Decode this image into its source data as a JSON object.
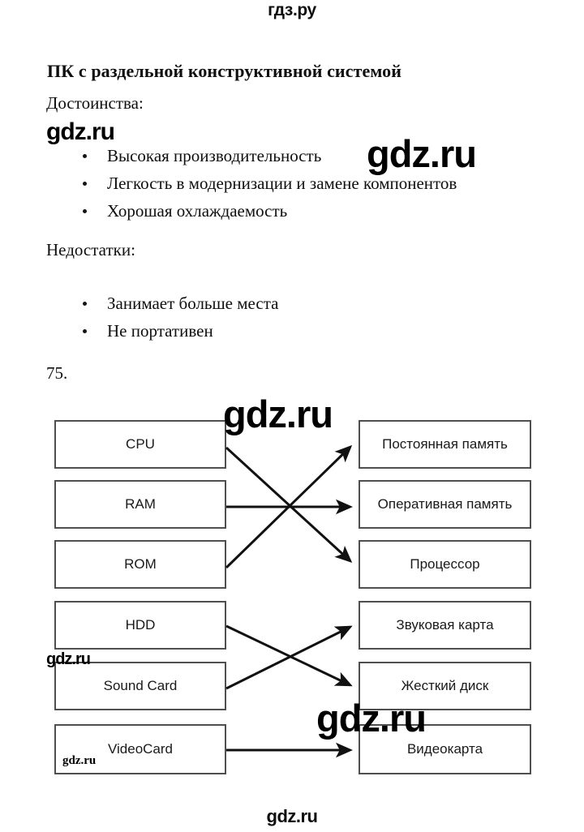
{
  "branding": {
    "header": "гдз.ру",
    "footer": "gdz.ru",
    "watermark": "gdz.ru"
  },
  "document": {
    "title": "ПК с раздельной конструктивной системой",
    "pros_label": "Достоинства:",
    "pros": [
      "Высокая производительность",
      "Легкость в модернизации и замене компонентов",
      "Хорошая охлаждаемость"
    ],
    "cons_label": "Недостатки:",
    "cons": [
      "Занимает больше места",
      "Не портативен"
    ],
    "task_number": "75."
  },
  "diagram": {
    "left_nodes": [
      {
        "label": "CPU"
      },
      {
        "label": "RAM"
      },
      {
        "label": "ROM"
      },
      {
        "label": "HDD"
      },
      {
        "label": "Sound Card"
      },
      {
        "label": "VideoCard"
      }
    ],
    "right_nodes": [
      {
        "label": "Постоянная память"
      },
      {
        "label": "Оперативная память"
      },
      {
        "label": "Процессор"
      },
      {
        "label": "Звуковая карта"
      },
      {
        "label": "Жесткий диск"
      },
      {
        "label": "Видеокарта"
      }
    ],
    "connections": [
      {
        "from": "CPU",
        "to": "Процессор"
      },
      {
        "from": "RAM",
        "to": "Оперативная память"
      },
      {
        "from": "ROM",
        "to": "Постоянная память"
      },
      {
        "from": "HDD",
        "to": "Жесткий диск"
      },
      {
        "from": "Sound Card",
        "to": "Звуковая карта"
      },
      {
        "from": "VideoCard",
        "to": "Видеокарта"
      }
    ]
  }
}
